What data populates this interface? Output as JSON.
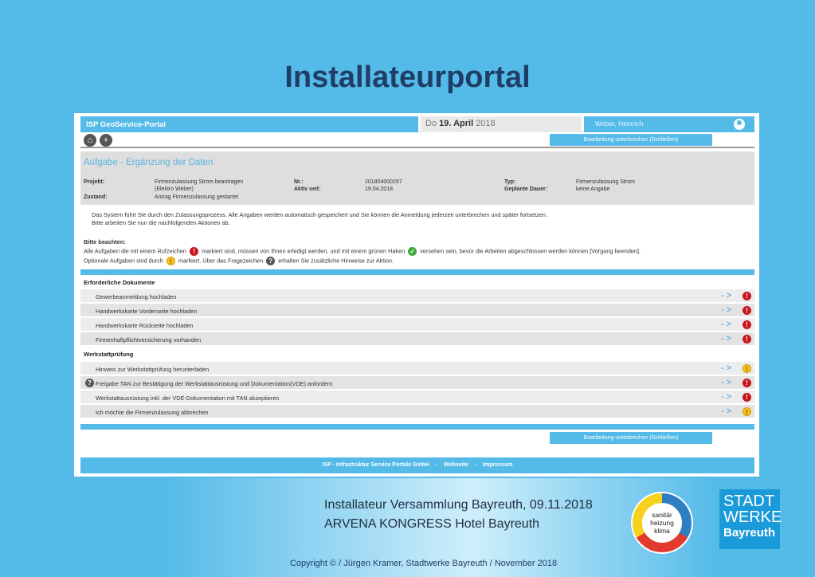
{
  "slide": {
    "title": "Installateurportal",
    "event_line1": "Installateur Versammlung Bayreuth, 09.11.2018",
    "event_line2": "ARVENA KONGRESS Hotel Bayreuth",
    "copyright": "Copyright © / Jürgen Kramer, Stadtwerke Bayreuth / November 2018",
    "logo_shk": [
      "sanitär",
      "heizung",
      "klima"
    ],
    "logo_sw": [
      "STADT",
      "WERKE",
      "Bayreuth"
    ]
  },
  "portal": {
    "brand": "ISP GeoService-Portal",
    "date_prefix": "Do",
    "date_bold": "19. April",
    "date_year": "2018",
    "user": "Weber, Heinrich",
    "home_icon": "home-icon",
    "add_icon": "plus-icon",
    "pause_button": "Bearbeitung unterbrechen (Schließen)",
    "task_title": "Aufgabe - Ergänzung der Daten",
    "task": {
      "projekt_label": "Projekt:",
      "projekt_value_1": "Firmenzulassung Strom beantragen",
      "projekt_value_2": "(Elektro Weber)",
      "zustand_label": "Zustand:",
      "zustand_value": "Antrag Firmenzulassung gestartet",
      "nr_label": "Nr.:",
      "nr_value": "201804000297",
      "aktiv_label": "Aktiv seit:",
      "aktiv_value": "19.04.2018",
      "typ_label": "Typ:",
      "typ_value": "Firmenzulassung Strom",
      "dauer_label": "Geplante Dauer:",
      "dauer_value": "keine Angabe"
    },
    "info": {
      "line1": "Das System führt Sie durch den Zulassungsprozess. Alle Angaben werden automatisch gespeichert und Sie können die Anmeldung jederzeit unterbrechen und später fortsetzen.",
      "line2": "Bitte arbeiten Sie nun die nachfolgenden Aktionen ab.",
      "note_head": "Bitte beachten:",
      "note1_a": "Alle Aufgaben die mit einem Rufzeichen",
      "note1_b": "markiert sind, müssen von Ihnen erledigt werden, und mit einem grünen Haken",
      "note1_c": "versehen sein, bevor die Arbeiten abgeschlossen werden können [Vorgang beenden].",
      "note2_a": "Optionale Aufgaben sind durch",
      "note2_b": "markiert. Über das Fragezeichen",
      "note2_c": "erhalten Sie zusätzliche Hinweise zur Aktion."
    },
    "sections": [
      {
        "title": "Erforderliche Dokumente",
        "rows": [
          {
            "label": "Gewerbeanmeldung hochladen",
            "status": "required"
          },
          {
            "label": "Handwerkskarte Vorderseite hochladen",
            "status": "required"
          },
          {
            "label": "Handwerkskarte Rückseite hochladen",
            "status": "required"
          },
          {
            "label": "Firmenhaftpflichtversicherung vorhanden",
            "status": "required"
          }
        ]
      },
      {
        "title": "Werkstattprüfung",
        "rows": [
          {
            "label": "Hinweis zur Werkstattprüfung herunterladen",
            "status": "optional"
          },
          {
            "label": "Freigabe TAN zur Bestätigung der Werkstattausrüstung und Dokumentation(VDE) anfordern",
            "status": "required",
            "help": true
          },
          {
            "label": "Werkstattausrüstung inkl. der VDE-Dokumentation mit TAN akzeptieren",
            "status": "required"
          },
          {
            "label": "Ich möchte die Firmenzulassung abbrechen",
            "status": "optional"
          }
        ]
      }
    ],
    "row_arrow": "- >",
    "footer": {
      "company": "ISP - Infrastruktur Service Portale GmbH",
      "link1": "Webseite",
      "link2": "Impressum",
      "sep": "-"
    },
    "colors": {
      "accent": "#54bae8",
      "required": "#c8161d",
      "done": "#3aaa35",
      "optional": "#f4c01e",
      "title": "#1f3e67"
    }
  }
}
